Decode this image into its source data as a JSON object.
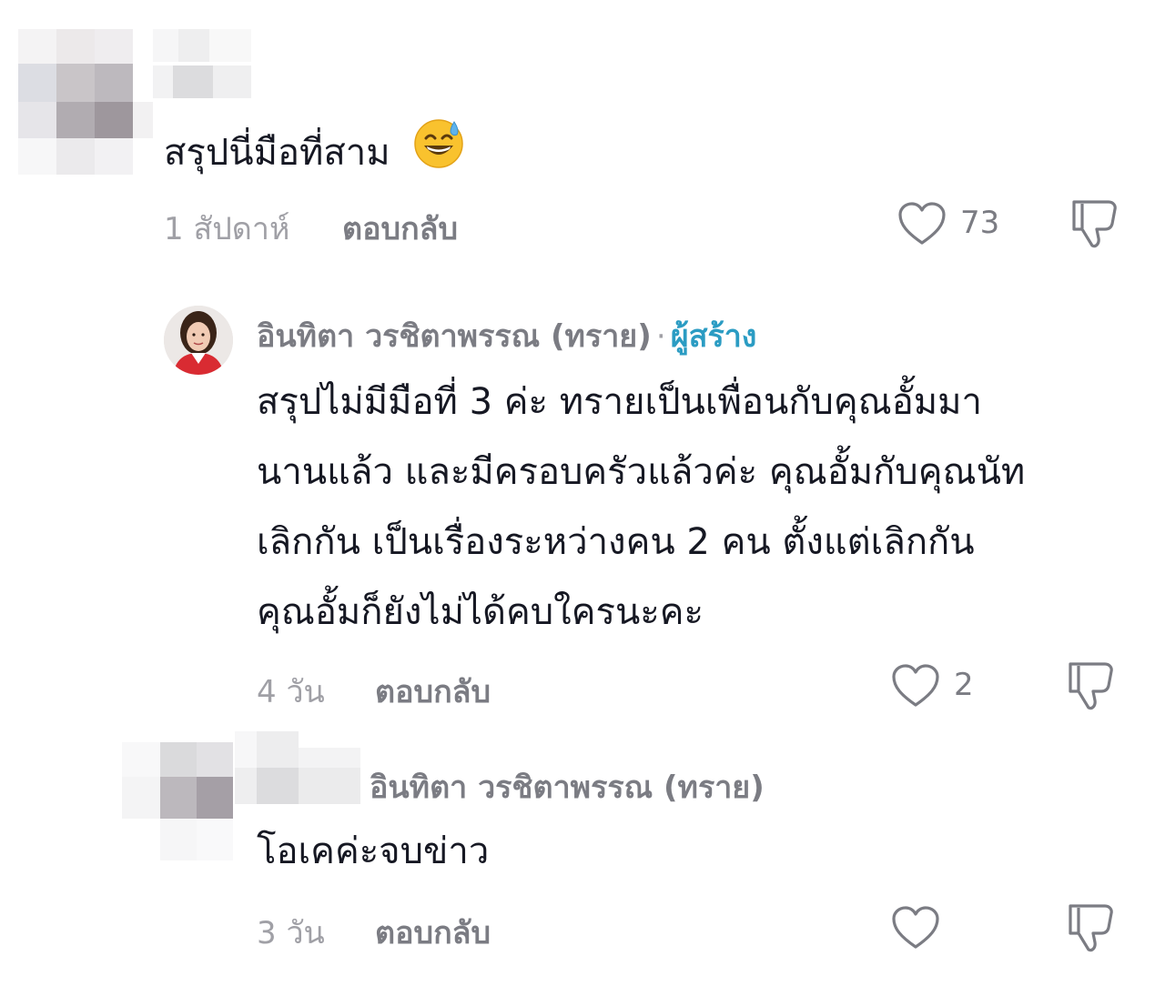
{
  "comments": [
    {
      "text": "สรุปนี่มือที่สาม",
      "emoji": "😅",
      "time": "1 สัปดาห์",
      "reply_label": "ตอบกลับ",
      "likes": "73"
    },
    {
      "username": "อินทิตา วรชิตาพรรณ (ทราย)",
      "separator": "·",
      "badge": "ผู้สร้าง",
      "text_lines": [
        "สรุปไม่มีมือที่ 3 ค่ะ ทรายเป็นเพื่อนกับคุณอั้มมา",
        "นานแล้ว และมีครอบครัวแล้วค่ะ คุณอั้มกับคุณนัท",
        "เลิกกัน เป็นเรื่องระหว่างคน 2 คน ตั้งแต่เลิกกัน",
        "คุณอั้มก็ยังไม่ได้คบใครนะคะ"
      ],
      "time": "4 วัน",
      "reply_label": "ตอบกลับ",
      "likes": "2"
    },
    {
      "reply_to": "อินทิตา วรชิตาพรรณ (ทราย)",
      "text": "โอเคค่ะจบข่าว",
      "time": "3 วัน",
      "reply_label": "ตอบกลับ"
    }
  ],
  "icons": {
    "like": "heart-outline-icon",
    "dislike": "thumbs-down-outline-icon"
  },
  "colors": {
    "text": "#161823",
    "muted": "#a0a0a6",
    "secondary": "#7b7c83",
    "creator": "#2b9cc3"
  }
}
